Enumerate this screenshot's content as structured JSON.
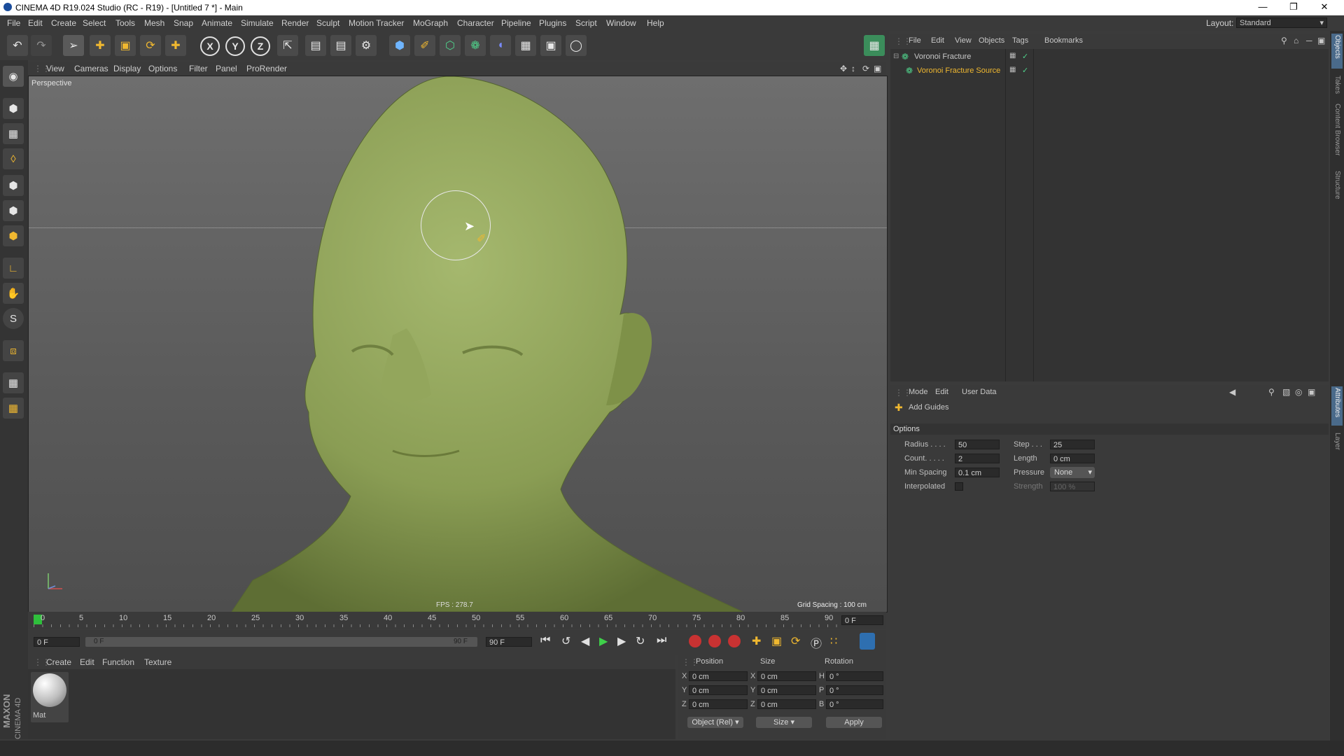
{
  "window": {
    "title": "CINEMA 4D R19.024 Studio (RC - R19) - [Untitled 7 *] - Main",
    "layout_label": "Layout:",
    "layout_value": "Standard"
  },
  "menubar": [
    "File",
    "Edit",
    "Create",
    "Select",
    "Tools",
    "Mesh",
    "Snap",
    "Animate",
    "Simulate",
    "Render",
    "Sculpt",
    "Motion Tracker",
    "MoGraph",
    "Character",
    "Pipeline",
    "Plugins",
    "Script",
    "Window",
    "Help"
  ],
  "viewport": {
    "menu": [
      "View",
      "Cameras",
      "Display",
      "Options",
      "Filter",
      "Panel",
      "ProRender"
    ],
    "label": "Perspective",
    "fps": "FPS : 278.7",
    "grid_spacing": "Grid Spacing : 100 cm"
  },
  "timeline": {
    "ticks": [
      "0",
      "5",
      "10",
      "15",
      "20",
      "25",
      "30",
      "35",
      "40",
      "45",
      "50",
      "55",
      "60",
      "65",
      "70",
      "75",
      "80",
      "85",
      "90"
    ],
    "end_frame": "0 F",
    "start_field": "0 F",
    "range_start": "0 F",
    "range_end": "90 F",
    "max_field": "90 F"
  },
  "material_manager": {
    "menu": [
      "Create",
      "Edit",
      "Function",
      "Texture"
    ],
    "material_name": "Mat"
  },
  "brand": {
    "line1": "MAXON",
    "line2": "CINEMA 4D"
  },
  "coordinates": {
    "headers": [
      "Position",
      "Size",
      "Rotation"
    ],
    "pos": [
      {
        "axis": "X",
        "value": "0 cm"
      },
      {
        "axis": "Y",
        "value": "0 cm"
      },
      {
        "axis": "Z",
        "value": "0 cm"
      }
    ],
    "size": [
      {
        "axis": "X",
        "value": "0 cm"
      },
      {
        "axis": "Y",
        "value": "0 cm"
      },
      {
        "axis": "Z",
        "value": "0 cm"
      }
    ],
    "rot": [
      {
        "axis": "H",
        "value": "0 °"
      },
      {
        "axis": "P",
        "value": "0 °"
      },
      {
        "axis": "B",
        "value": "0 °"
      }
    ],
    "mode_select": "Object (Rel)",
    "size_select": "Size",
    "apply": "Apply"
  },
  "object_manager": {
    "menu": [
      "File",
      "Edit",
      "View",
      "Objects",
      "Tags",
      "Bookmarks"
    ],
    "objects": [
      {
        "name": "Voronoi Fracture",
        "color": "#cfcfcf"
      },
      {
        "name": "Voronoi Fracture Source",
        "color": "#f0b830"
      }
    ]
  },
  "attributes": {
    "menu": [
      "Mode",
      "Edit",
      "User Data"
    ],
    "tool_name": "Add Guides",
    "section": "Options",
    "params_left": [
      {
        "label": "Radius . . . .",
        "value": "50"
      },
      {
        "label": "Count. . . . .",
        "value": "2"
      },
      {
        "label": "Min Spacing",
        "value": "0.1 cm"
      },
      {
        "label": "Interpolated",
        "value": ""
      }
    ],
    "params_right": [
      {
        "label": "Step . . .",
        "value": "25"
      },
      {
        "label": "Length",
        "value": "0 cm"
      },
      {
        "label": "Pressure",
        "value": "None"
      },
      {
        "label": "Strength",
        "value": "100 %"
      }
    ]
  },
  "right_tabs": [
    "Objects",
    "Takes",
    "Content Browser",
    "Structure"
  ],
  "right_tabs_lower": [
    "Attributes",
    "Layer"
  ],
  "colors": {
    "accent_orange": "#f0b830",
    "head_green": "#8ea35a",
    "timeline_green": "#2fbf3c"
  }
}
